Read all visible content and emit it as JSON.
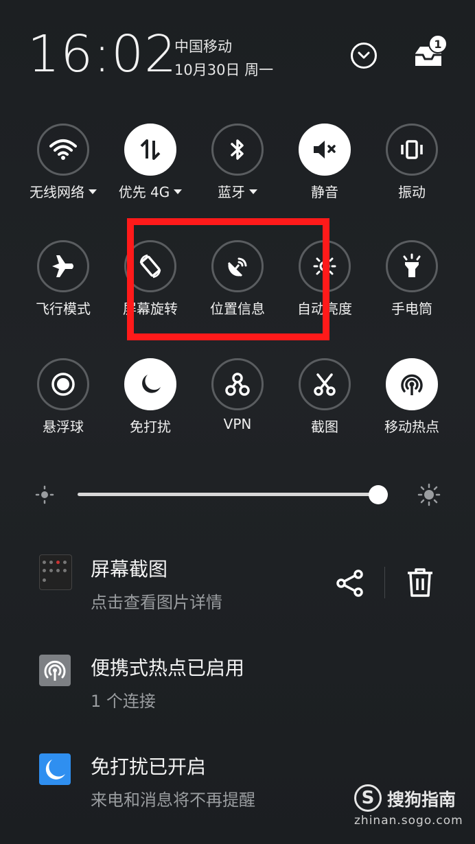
{
  "header": {
    "time": "16:02",
    "carrier": "中国移动",
    "date": "10月30日 周一",
    "inbox_count": "1"
  },
  "toggles": [
    {
      "label": "无线网络",
      "icon": "wifi-icon",
      "state": "off",
      "has_menu": true
    },
    {
      "label": "优先 4G",
      "icon": "mobile-data-icon",
      "state": "on",
      "has_menu": true
    },
    {
      "label": "蓝牙",
      "icon": "bluetooth-icon",
      "state": "off",
      "has_menu": true
    },
    {
      "label": "静音",
      "icon": "mute-icon",
      "state": "on",
      "has_menu": false
    },
    {
      "label": "振动",
      "icon": "vibrate-icon",
      "state": "off",
      "has_menu": false
    },
    {
      "label": "飞行模式",
      "icon": "airplane-icon",
      "state": "off",
      "has_menu": false
    },
    {
      "label": "屏幕旋转",
      "icon": "screen-rotate-icon",
      "state": "off",
      "has_menu": false
    },
    {
      "label": "位置信息",
      "icon": "location-icon",
      "state": "off",
      "has_menu": false
    },
    {
      "label": "自动亮度",
      "icon": "auto-brightness-icon",
      "state": "off",
      "has_menu": false
    },
    {
      "label": "手电筒",
      "icon": "flashlight-icon",
      "state": "off",
      "has_menu": false
    },
    {
      "label": "悬浮球",
      "icon": "floating-ball-icon",
      "state": "off",
      "has_menu": false
    },
    {
      "label": "免打扰",
      "icon": "do-not-disturb-icon",
      "state": "on",
      "has_menu": false
    },
    {
      "label": "VPN",
      "icon": "vpn-icon",
      "state": "off",
      "has_menu": false
    },
    {
      "label": "截图",
      "icon": "screenshot-icon",
      "state": "off",
      "has_menu": false
    },
    {
      "label": "移动热点",
      "icon": "hotspot-icon",
      "state": "on",
      "has_menu": false
    }
  ],
  "brightness": {
    "level": 0.97
  },
  "notifications": [
    {
      "title": "屏幕截图",
      "subtitle": "点击查看图片详情",
      "icon": "screenshot-thumbnail"
    },
    {
      "title": "便携式热点已启用",
      "subtitle": "1 个连接",
      "icon": "hotspot-icon"
    },
    {
      "title": "免打扰已开启",
      "subtitle": "来电和消息将不再提醒",
      "icon": "moon-icon"
    }
  ],
  "watermark": {
    "logo_letter": "S",
    "brand": "搜狗指南",
    "url": "zhinan.sogo.com"
  },
  "colors": {
    "background": "#1d2023",
    "highlight": "#ff1a1a",
    "dnd_blue": "#2f8ff0",
    "hotspot_gray": "#7d8084"
  }
}
